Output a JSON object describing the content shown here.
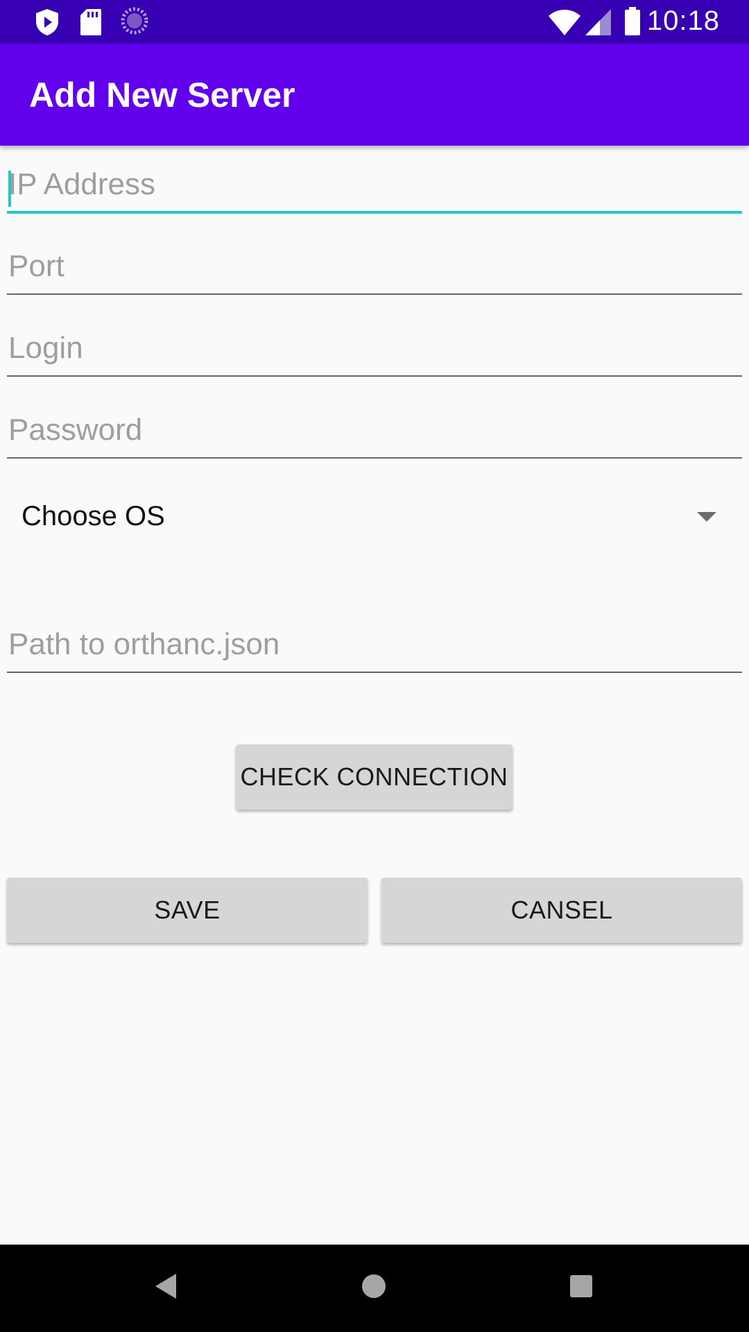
{
  "status_bar": {
    "time": "10:18",
    "icons": [
      "play-protect-icon",
      "sd-card-icon",
      "loading-icon",
      "wifi-icon",
      "signal-icon",
      "battery-icon"
    ]
  },
  "app_bar": {
    "title": "Add New Server"
  },
  "form": {
    "ip_address": {
      "placeholder": "IP Address",
      "value": ""
    },
    "port": {
      "placeholder": "Port",
      "value": ""
    },
    "login": {
      "placeholder": "Login",
      "value": ""
    },
    "password": {
      "placeholder": "Password",
      "value": ""
    },
    "os_select": {
      "selected": "Choose OS"
    },
    "path": {
      "placeholder": "Path to orthanc.json",
      "value": ""
    }
  },
  "buttons": {
    "check_connection": "CHECK CONNECTION",
    "save": "SAVE",
    "cancel": "CANSEL"
  },
  "colors": {
    "status_bar": "#3700b3",
    "app_bar": "#6200ee",
    "accent": "#1fc9c0",
    "background": "#fafafa",
    "button": "#d6d6d6"
  }
}
